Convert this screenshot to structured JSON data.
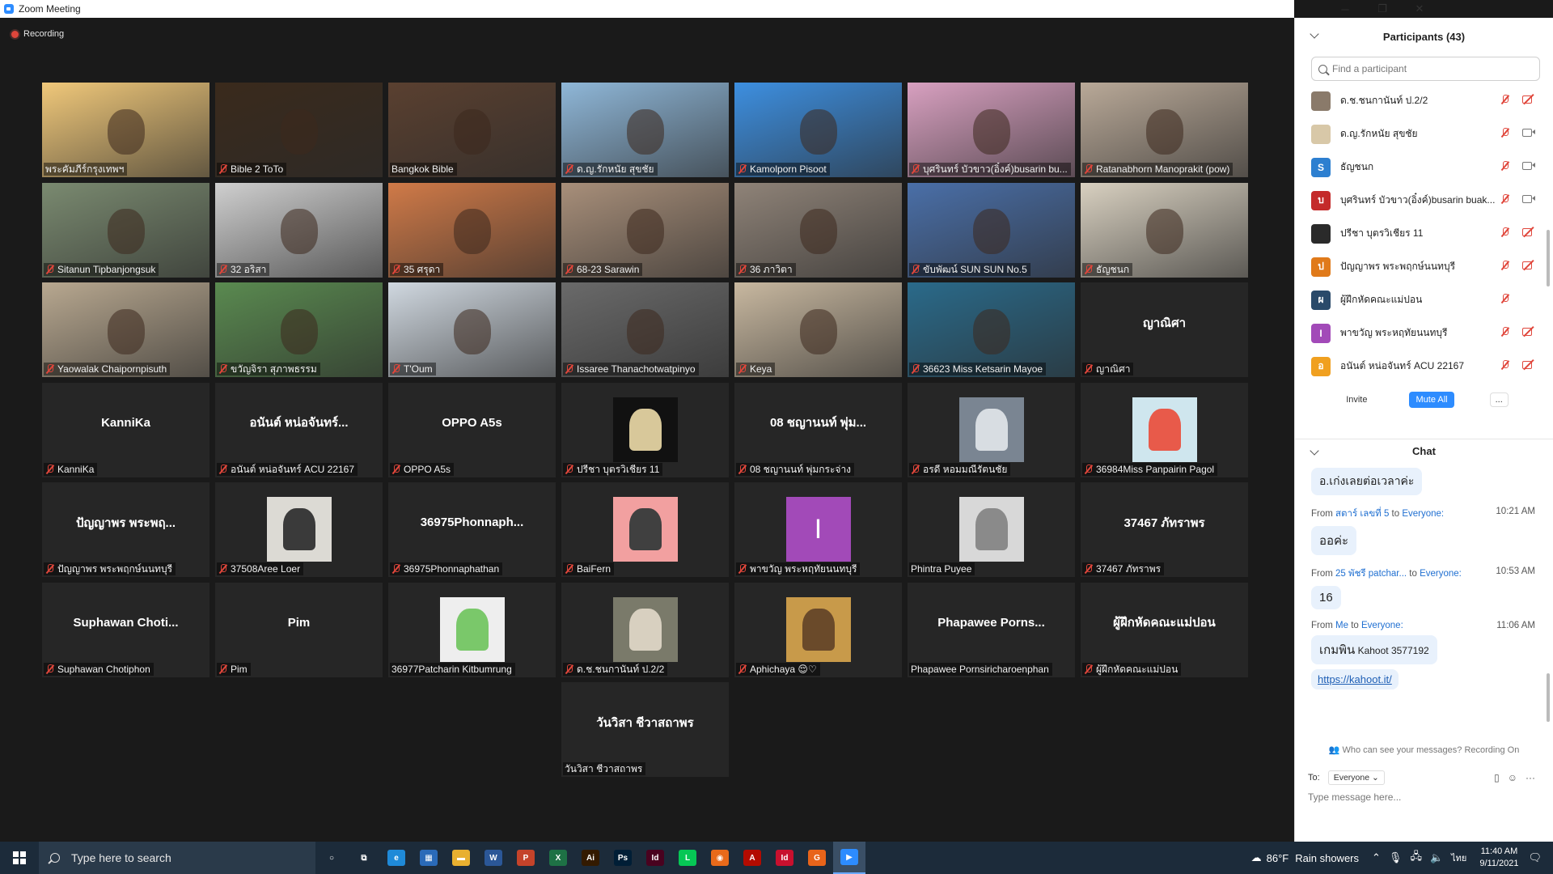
{
  "window": {
    "title": "Zoom Meeting",
    "minimize": "─",
    "maximize": "❐",
    "close": "✕"
  },
  "recording_label": "Recording",
  "tiles": [
    {
      "label": "พระคัมภีร์กรุงเทพฯ",
      "muted": false,
      "kind": "video",
      "bg": "#f0c87a"
    },
    {
      "label": "Bible 2 ToTo",
      "muted": true,
      "kind": "video",
      "bg": "#3a2a1c"
    },
    {
      "label": "Bangkok Bible",
      "muted": false,
      "kind": "video",
      "bg": "#5a4030",
      "active": true
    },
    {
      "label": "ด.ญ.รักหนัย สุขชัย",
      "muted": true,
      "kind": "video",
      "bg": "#8fb7d8"
    },
    {
      "label": "Kamolporn Pisoot",
      "muted": true,
      "kind": "video",
      "bg": "#3d8fe0"
    },
    {
      "label": "บุศรินทร์ บัวขาว(อิ๋งค์)busarin bu...",
      "muted": true,
      "kind": "video",
      "bg": "#d8a0c0"
    },
    {
      "label": "Ratanabhorn Manoprakit (pow)",
      "muted": true,
      "kind": "video",
      "bg": "#b9a998"
    },
    {
      "label": "Sitanun Tipbanjongsuk",
      "muted": true,
      "kind": "video",
      "bg": "#7a8a70"
    },
    {
      "label": "32 อริสา",
      "muted": true,
      "kind": "video",
      "bg": "#cfcfcf"
    },
    {
      "label": "35 ศรุดา",
      "muted": true,
      "kind": "video",
      "bg": "#d07a48"
    },
    {
      "label": "68-23 Sarawin",
      "muted": true,
      "kind": "video",
      "bg": "#a88f7a"
    },
    {
      "label": "36 ภาวิตา",
      "muted": true,
      "kind": "video",
      "bg": "#8f8378"
    },
    {
      "label": "ขับพัฒน์ SUN SUN No.5",
      "muted": true,
      "kind": "video",
      "bg": "#4a6fa8"
    },
    {
      "label": "ธัญชนก",
      "muted": true,
      "kind": "video",
      "bg": "#d8d0c0"
    },
    {
      "label": "Yaowalak Chaipornpisuth",
      "muted": true,
      "kind": "video",
      "bg": "#b8a890"
    },
    {
      "label": "ขวัญจิรา สุภาพธรรม",
      "muted": true,
      "kind": "video",
      "bg": "#5a8a50"
    },
    {
      "label": "T'Oum",
      "muted": true,
      "kind": "video",
      "bg": "#d0d8e0"
    },
    {
      "label": "Issaree Thanachotwatpinyo",
      "muted": true,
      "kind": "video",
      "bg": "#6a6a6a"
    },
    {
      "label": "Keya",
      "muted": true,
      "kind": "video",
      "bg": "#c8b8a0"
    },
    {
      "label": "36623 Miss Ketsarin Mayoe",
      "muted": true,
      "kind": "video",
      "bg": "#2a6a8a"
    },
    {
      "label": "ญาณิศา",
      "muted": true,
      "kind": "name",
      "display": "ญาณิศา"
    },
    {
      "label": "KanniKa",
      "muted": true,
      "kind": "name",
      "display": "KanniKa"
    },
    {
      "label": "อนันต์ หน่อจันทร์ ACU 22167",
      "muted": true,
      "kind": "name",
      "display": "อนันต์ หน่อจันทร์..."
    },
    {
      "label": "OPPO A5s",
      "muted": true,
      "kind": "name",
      "display": "OPPO A5s"
    },
    {
      "label": "ปรีชา บุตรวิเชียร 11",
      "muted": true,
      "kind": "avatar",
      "bg": "#111111",
      "inner": "#d8c89a"
    },
    {
      "label": "08 ชญานนท์ พุ่มกระจ่าง",
      "muted": true,
      "kind": "name",
      "display": "08 ชญานนท์ พุ่ม..."
    },
    {
      "label": "อรดี หอมมณีรัตนชัย",
      "muted": true,
      "kind": "avatar",
      "bg": "#7a8592",
      "inner": "#d8dde2"
    },
    {
      "label": "36984Miss Panpairin Pagol",
      "muted": true,
      "kind": "avatar",
      "bg": "#cfe6ee",
      "inner": "#e85a4a"
    },
    {
      "label": "ปัญญาพร พระพฤกษ์นนทบุรี",
      "muted": true,
      "kind": "name",
      "display": "ปัญญาพร พระพฤ..."
    },
    {
      "label": "37508Aree Loer",
      "muted": true,
      "kind": "avatar",
      "bg": "#dcdad4",
      "inner": "#3a3a3a"
    },
    {
      "label": "36975Phonnaphathan",
      "muted": true,
      "kind": "name",
      "display": "36975Phonnaph..."
    },
    {
      "label": "BaiFern",
      "muted": true,
      "kind": "avatar",
      "bg": "#f2a0a0",
      "inner": "#404040"
    },
    {
      "label": "พาขวัญ พระหฤทัยนนทบุรี",
      "muted": true,
      "kind": "letter",
      "bg": "#a24ab8",
      "letter": "I"
    },
    {
      "label": "Phintra Puyee",
      "muted": false,
      "kind": "avatar",
      "bg": "#d8d8d8",
      "inner": "#8a8a8a"
    },
    {
      "label": "37467 ภัทราพร",
      "muted": true,
      "kind": "name",
      "display": "37467 ภัทราพร"
    },
    {
      "label": "Suphawan Chotiphon",
      "muted": true,
      "kind": "name",
      "display": "Suphawan Choti..."
    },
    {
      "label": "Pim",
      "muted": true,
      "kind": "name",
      "display": "Pim"
    },
    {
      "label": "36977Patcharin Kitbumrung",
      "muted": false,
      "kind": "avatar",
      "bg": "#eeeeee",
      "inner": "#7ac86a"
    },
    {
      "label": "ด.ช.ชนกานันท์ ป.2/2",
      "muted": true,
      "kind": "avatar",
      "bg": "#7a7a6a",
      "inner": "#d8d0c0"
    },
    {
      "label": "Aphichaya 😌♡",
      "muted": true,
      "kind": "avatar",
      "bg": "#c89a4a",
      "inner": "#6a4a2a"
    },
    {
      "label": "Phapawee Pornsiricharoenphan",
      "muted": false,
      "kind": "name",
      "display": "Phapawee Porns..."
    },
    {
      "label": "ผู้ฝึกหัดคณะแม่ปอน",
      "muted": true,
      "kind": "name",
      "display": "ผู้ฝึกหัดคณะแม่ปอน"
    },
    {
      "label": "วันวิสา ชีวาสถาพร",
      "muted": false,
      "kind": "name",
      "display": "วันวิสา ชีวาสถาพร"
    }
  ],
  "participants": {
    "title": "Participants (43)",
    "search_placeholder": "Find a participant",
    "items": [
      {
        "name": "ด.ช.ชนกานันท์ ป.2/2",
        "avatar": "",
        "color": "#8a7a6a",
        "video": "off"
      },
      {
        "name": "ด.ญ.รักหนัย สุขชัย",
        "avatar": "",
        "color": "#d8c8a8",
        "video": "on"
      },
      {
        "name": "ธัญชนก",
        "avatar": "S",
        "color": "#2d7fd0",
        "video": "on"
      },
      {
        "name": "บุศรินทร์ บัวขาว(อิ๋งค์)busarin buak...",
        "avatar": "บ",
        "color": "#c42b2b",
        "video": "on"
      },
      {
        "name": "ปรีชา บุตรวิเชียร 11",
        "avatar": "",
        "color": "#2a2a2a",
        "video": "off"
      },
      {
        "name": "ปัญญาพร พระพฤกษ์นนทบุรี",
        "avatar": "ป",
        "color": "#e07a1a",
        "video": "off"
      },
      {
        "name": "ผู้ฝึกหัดคณะแม่ปอน",
        "avatar": "ผ",
        "color": "#2a4a6a",
        "video": "none"
      },
      {
        "name": "พาขวัญ พระหฤทัยนนทบุรี",
        "avatar": "I",
        "color": "#a24ab8",
        "video": "off"
      },
      {
        "name": "อนันต์ หน่อจันทร์ ACU 22167",
        "avatar": "อ",
        "color": "#f0a020",
        "video": "off"
      }
    ],
    "invite": "Invite",
    "mute_all": "Mute All",
    "more": "..."
  },
  "chat": {
    "title": "Chat",
    "first_bubble": "อ.เก่งเลยต่อเวลาค่ะ",
    "messages": [
      {
        "from_label": "From",
        "sender": "สตาร์ เลขที่ 5",
        "to_label": "to",
        "to": "Everyone:",
        "time": "10:21 AM",
        "text": "ออค่ะ"
      },
      {
        "from_label": "From",
        "sender": "25 พัชรี patchar...",
        "to_label": "to",
        "to": "Everyone:",
        "time": "10:53 AM",
        "text": "16"
      },
      {
        "from_label": "From",
        "sender": "Me",
        "to_label": "to",
        "to": "Everyone:",
        "time": "11:06 AM",
        "text": "เกมพิน",
        "text_sub": "Kahoot 3577192",
        "link": "https://kahoot.it/"
      }
    ],
    "who_can_see": "Who can see your messages? Recording On",
    "to_label": "To:",
    "to_value": "Everyone ⌄",
    "input_placeholder": "Type message here..."
  },
  "taskbar": {
    "search_placeholder": "Type here to search",
    "apps": [
      {
        "name": "cortana",
        "label": "○",
        "color": "transparent"
      },
      {
        "name": "task-view",
        "label": "⧉",
        "color": "transparent"
      },
      {
        "name": "edge",
        "label": "e",
        "color": "#1f8ad8"
      },
      {
        "name": "calculator",
        "label": "▦",
        "color": "#2a6ab8"
      },
      {
        "name": "file-explorer",
        "label": "▬",
        "color": "#e8b030"
      },
      {
        "name": "word",
        "label": "W",
        "color": "#2b5797"
      },
      {
        "name": "powerpoint",
        "label": "P",
        "color": "#c4432a"
      },
      {
        "name": "excel",
        "label": "X",
        "color": "#1e7145"
      },
      {
        "name": "illustrator",
        "label": "Ai",
        "color": "#331a00"
      },
      {
        "name": "photoshop",
        "label": "Ps",
        "color": "#001e36"
      },
      {
        "name": "indesign",
        "label": "Id",
        "color": "#49021f"
      },
      {
        "name": "line",
        "label": "L",
        "color": "#06c755"
      },
      {
        "name": "firefox",
        "label": "◉",
        "color": "#e86a1a"
      },
      {
        "name": "acrobat",
        "label": "A",
        "color": "#b30b00"
      },
      {
        "name": "indesign-2",
        "label": "Id",
        "color": "#c8102e"
      },
      {
        "name": "grammarly",
        "label": "G",
        "color": "#e8641a"
      },
      {
        "name": "zoom",
        "label": "▶",
        "color": "#2d8cff",
        "active": true
      }
    ],
    "weather_temp": "86°F",
    "weather_text": "Rain showers",
    "lang": "ไทย",
    "time": "11:40 AM",
    "date": "9/11/2021"
  }
}
